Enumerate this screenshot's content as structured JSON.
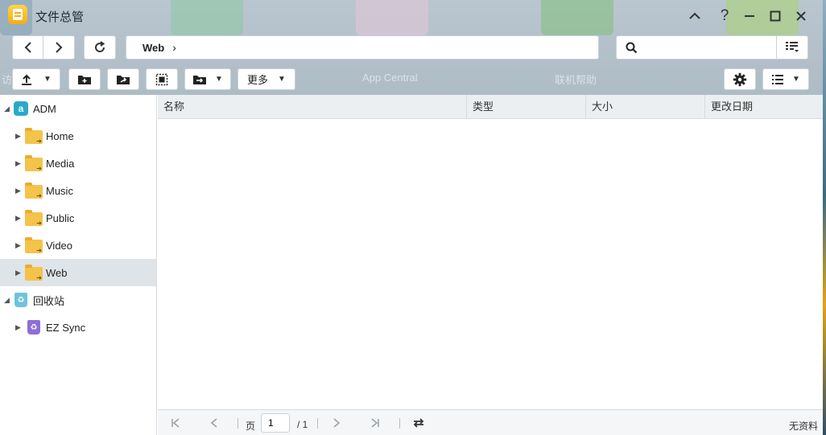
{
  "window": {
    "title": "文件总管"
  },
  "background": {
    "ghost_labels": [
      "访",
      "App Central",
      "联机帮助"
    ]
  },
  "navigation": {
    "path_segment": "Web",
    "search_placeholder": ""
  },
  "toolbar": {
    "more_label": "更多"
  },
  "sidebar": {
    "root_label": "ADM",
    "folders": [
      "Home",
      "Media",
      "Music",
      "Public",
      "Video",
      "Web"
    ],
    "selected": "Web",
    "recycle_label": "回收站",
    "ezsync_label": "EZ Sync"
  },
  "list": {
    "columns": [
      "名称",
      "类型",
      "大小",
      "更改日期"
    ]
  },
  "pager": {
    "page_label": "页",
    "current_page": "1",
    "total_pages": "/ 1",
    "status": "无资料"
  }
}
